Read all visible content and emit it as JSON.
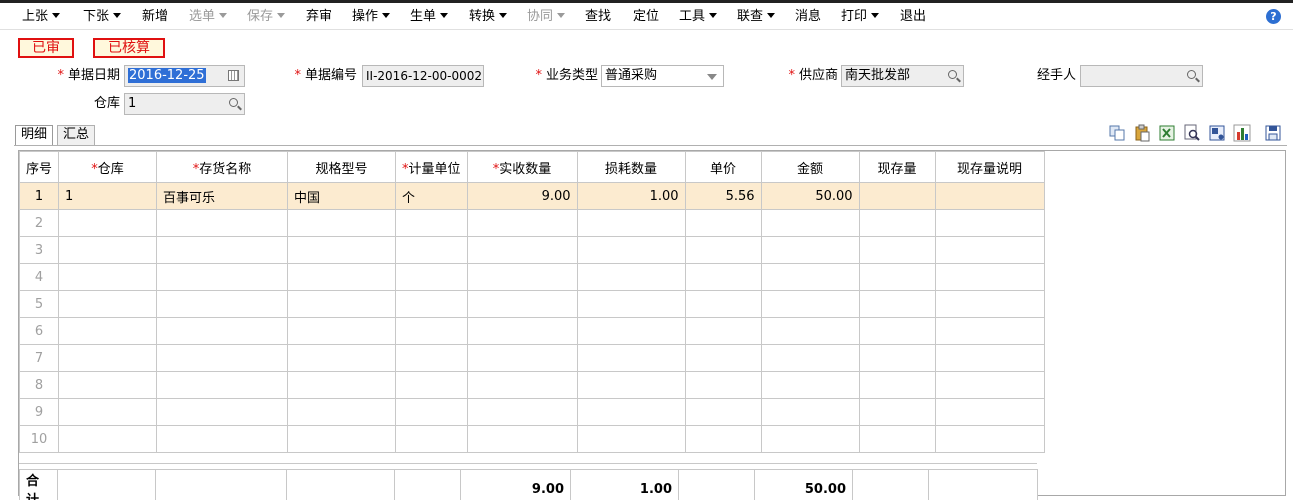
{
  "toolbar": {
    "items": [
      {
        "label": "上张",
        "caret": true,
        "disabled": false
      },
      {
        "label": "下张",
        "caret": true,
        "disabled": false
      },
      {
        "label": "新增",
        "caret": false,
        "disabled": false
      },
      {
        "label": "选单",
        "caret": true,
        "disabled": true
      },
      {
        "label": "保存",
        "caret": true,
        "disabled": true
      },
      {
        "label": "弃审",
        "caret": false,
        "disabled": false
      },
      {
        "label": "操作",
        "caret": true,
        "disabled": false
      },
      {
        "label": "生单",
        "caret": true,
        "disabled": false
      },
      {
        "label": "转换",
        "caret": true,
        "disabled": false
      },
      {
        "label": "协同",
        "caret": true,
        "disabled": true
      },
      {
        "label": "查找",
        "caret": false,
        "disabled": false
      },
      {
        "label": "定位",
        "caret": false,
        "disabled": false
      },
      {
        "label": "工具",
        "caret": true,
        "disabled": false
      },
      {
        "label": "联查",
        "caret": true,
        "disabled": false
      },
      {
        "label": "消息",
        "caret": false,
        "disabled": false
      },
      {
        "label": "打印",
        "caret": true,
        "disabled": false
      },
      {
        "label": "退出",
        "caret": false,
        "disabled": false
      }
    ],
    "help_icon": "question-icon"
  },
  "status": {
    "audited": "已审",
    "settled": "已核算"
  },
  "form": {
    "date_label": "单据日期",
    "date_value": "2016-12-25",
    "docno_label": "单据编号",
    "docno_value": "II-2016-12-00-0002",
    "biztype_label": "业务类型",
    "biztype_value": "普通采购",
    "supplier_label": "供应商",
    "supplier_value": "南天批发部",
    "handler_label": "经手人",
    "handler_value": "",
    "warehouse_label": "仓库",
    "warehouse_value": "1"
  },
  "tabs": [
    "明细",
    "汇总"
  ],
  "grid": {
    "columns": [
      {
        "label": "序号",
        "required": false
      },
      {
        "label": "仓库",
        "required": true
      },
      {
        "label": "存货名称",
        "required": true
      },
      {
        "label": "规格型号",
        "required": false
      },
      {
        "label": "计量单位",
        "required": true
      },
      {
        "label": "实收数量",
        "required": true
      },
      {
        "label": "损耗数量",
        "required": false
      },
      {
        "label": "单价",
        "required": false
      },
      {
        "label": "金额",
        "required": false
      },
      {
        "label": "现存量",
        "required": false
      },
      {
        "label": "现存量说明",
        "required": false
      }
    ],
    "rows": [
      [
        "1",
        "1",
        "百事可乐",
        "中国",
        "个",
        "9.00",
        "1.00",
        "5.56",
        "50.00",
        "",
        ""
      ],
      [
        "2",
        "",
        "",
        "",
        "",
        "",
        "",
        "",
        "",
        "",
        ""
      ],
      [
        "3",
        "",
        "",
        "",
        "",
        "",
        "",
        "",
        "",
        "",
        ""
      ],
      [
        "4",
        "",
        "",
        "",
        "",
        "",
        "",
        "",
        "",
        "",
        ""
      ],
      [
        "5",
        "",
        "",
        "",
        "",
        "",
        "",
        "",
        "",
        "",
        ""
      ],
      [
        "6",
        "",
        "",
        "",
        "",
        "",
        "",
        "",
        "",
        "",
        ""
      ],
      [
        "7",
        "",
        "",
        "",
        "",
        "",
        "",
        "",
        "",
        "",
        ""
      ],
      [
        "8",
        "",
        "",
        "",
        "",
        "",
        "",
        "",
        "",
        "",
        ""
      ],
      [
        "9",
        "",
        "",
        "",
        "",
        "",
        "",
        "",
        "",
        "",
        ""
      ],
      [
        "10",
        "",
        "",
        "",
        "",
        "",
        "",
        "",
        "",
        "",
        ""
      ]
    ],
    "total": {
      "label": "合计",
      "received_qty": "9.00",
      "loss_qty": "1.00",
      "amount": "50.00"
    }
  }
}
